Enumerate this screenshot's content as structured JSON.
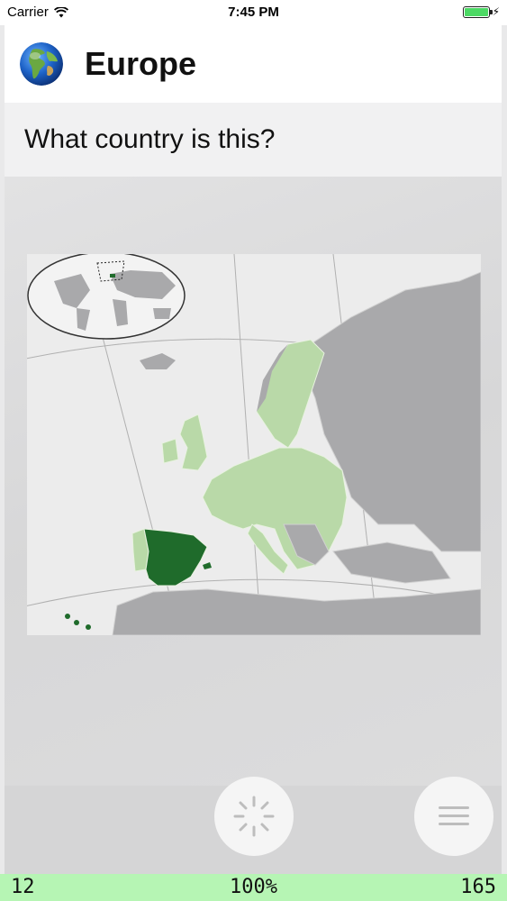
{
  "status_bar": {
    "carrier": "Carrier",
    "time": "7:45 PM",
    "battery_level": 1.0,
    "charging_symbol": "⚡"
  },
  "header": {
    "icon": "globe-icon",
    "title": "Europe"
  },
  "question": {
    "text": "What country is this?"
  },
  "map": {
    "highlight_color": "#1f6b2b",
    "eu_color": "#b9d9a8",
    "land_color": "#a9a9ab"
  },
  "controls": {
    "loading_icon": "spinner-icon",
    "menu_icon": "hamburger-menu-icon"
  },
  "score": {
    "left": "12",
    "center": "100%",
    "right": "165",
    "bar_color": "#b6f5b4"
  }
}
